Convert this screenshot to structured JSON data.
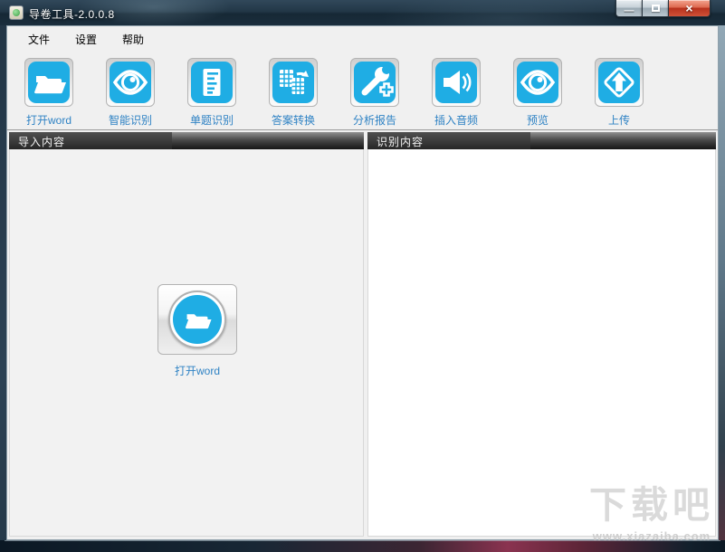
{
  "window": {
    "title": "导卷工具-2.0.0.8",
    "controls": {
      "minimize_glyph": "—",
      "close_glyph": "×"
    }
  },
  "menu": {
    "items": [
      "文件",
      "设置",
      "帮助"
    ]
  },
  "toolbar": {
    "buttons": [
      {
        "label": "打开word",
        "icon": "open-folder-icon"
      },
      {
        "label": "智能识别",
        "icon": "eye-icon"
      },
      {
        "label": "单题识别",
        "icon": "document-icon"
      },
      {
        "label": "答案转换",
        "icon": "convert-icon"
      },
      {
        "label": "分析报告",
        "icon": "report-icon"
      },
      {
        "label": "插入音频",
        "icon": "audio-icon"
      },
      {
        "label": "预览",
        "icon": "eye-icon"
      },
      {
        "label": "上传",
        "icon": "upload-icon"
      }
    ]
  },
  "panels": {
    "left": {
      "title": "导入内容",
      "open_button_label": "打开word"
    },
    "right": {
      "title": "识别内容"
    }
  },
  "watermark": {
    "title": "下载吧",
    "url": "www.xiazaiba.com"
  },
  "colors": {
    "accent_cyan": "#1FADE4",
    "toolbar_label_blue": "#2E82C4",
    "close_red": "#C23B25"
  }
}
